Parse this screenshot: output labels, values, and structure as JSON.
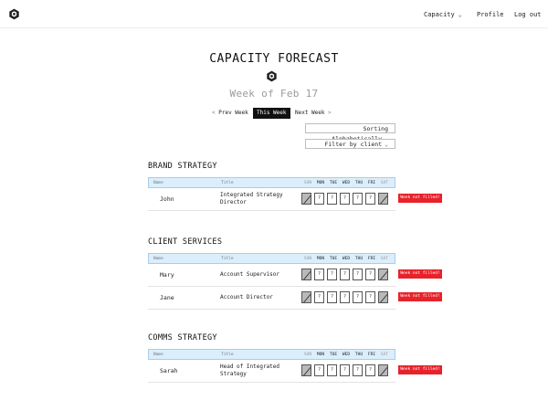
{
  "nav": {
    "capacity": "Capacity",
    "profile": "Profile",
    "logout": "Log out"
  },
  "page": {
    "title": "CAPACITY FORECAST",
    "week": "Week of Feb 17"
  },
  "week_nav": {
    "prev": "Prev Week",
    "this": "This Week",
    "next": "Next Week"
  },
  "controls": {
    "sort": "Sorting Alphabetically",
    "filter": "Filter by client"
  },
  "table_headers": {
    "name": "Name",
    "title": "Title",
    "days": [
      "SUN",
      "MON",
      "TUE",
      "WED",
      "THU",
      "FRI",
      "SAT"
    ]
  },
  "cell_placeholder": "?",
  "sections": [
    {
      "name": "BRAND STRATEGY",
      "rows": [
        {
          "name": "John",
          "title": "Integrated Strategy Director",
          "status": "Week not filled!"
        }
      ]
    },
    {
      "name": "CLIENT SERVICES",
      "rows": [
        {
          "name": "Mary",
          "title": "Account Supervisor",
          "status": "Week not filled!"
        },
        {
          "name": "Jane",
          "title": "Account Director",
          "status": "Week not filled!"
        }
      ]
    },
    {
      "name": "COMMS STRATEGY",
      "rows": [
        {
          "name": "Sarah",
          "title": "Head of Integrated Strategy",
          "status": "Week not filled!"
        }
      ]
    }
  ],
  "colors": {
    "badge": "#e8222b",
    "header_bg": "#dbeefc",
    "weekend_cell": "#b9b9b9"
  },
  "icons": {
    "logo": "hexagon-cube-icon",
    "caret": "chevron-down-icon"
  }
}
